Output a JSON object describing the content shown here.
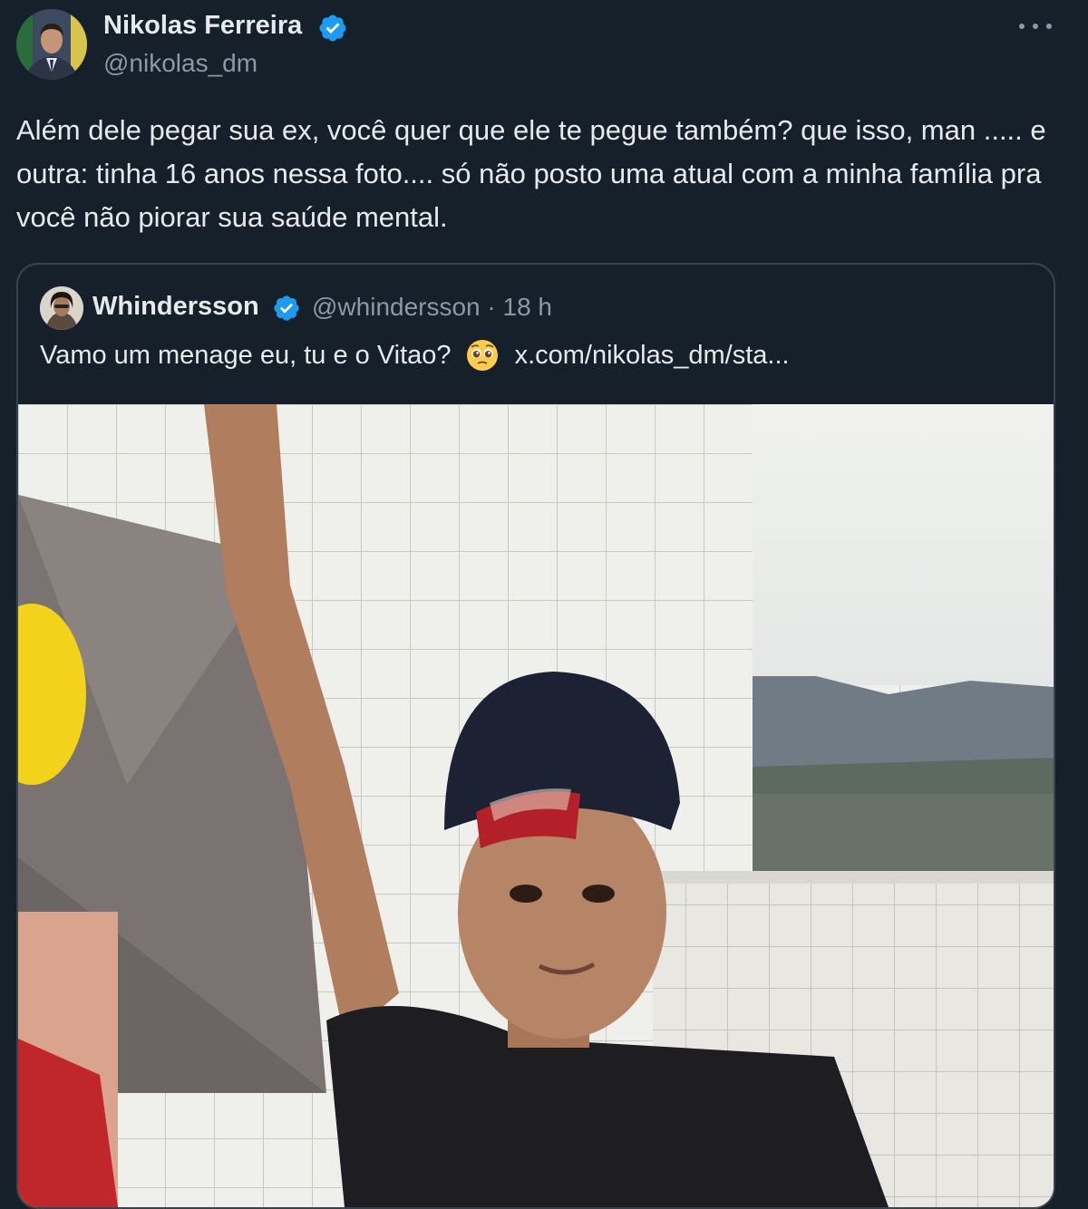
{
  "tweet": {
    "author": {
      "name": "Nikolas Ferreira",
      "handle": "@nikolas_dm"
    },
    "text": "Além dele pegar sua ex, você quer que ele te pegue também? que isso, man ..... e outra: tinha 16 anos nessa foto.... só não posto uma atual com a minha família pra você não piorar sua saúde mental."
  },
  "quote": {
    "name": "Whindersson",
    "handle_time": "@whindersson · 18 h",
    "text": "Vamo um menage eu, tu e o Vitao?",
    "emoji": "pleading-face-emoji",
    "link": "x.com/nikolas_dm/sta..."
  },
  "colors": {
    "background": "#15202b",
    "text": "#e7e9ea",
    "secondary": "#8b98a5",
    "verified": "#1d9bf0",
    "border": "#38444d"
  },
  "icons": [
    "verified-badge-icon",
    "more-options-icon"
  ]
}
